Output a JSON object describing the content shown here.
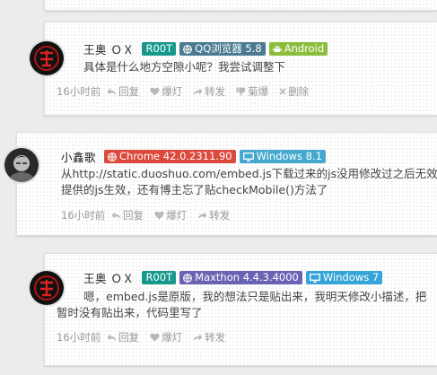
{
  "comments": [
    {
      "user": "王奥 ＯＸ",
      "badges": [
        {
          "label": "R00T",
          "icon": "",
          "color": "#17988c"
        },
        {
          "label": "QQ浏览器 5.8",
          "icon": "globe-icon",
          "color": "#4a7a92"
        },
        {
          "label": "Android",
          "icon": "android-icon",
          "color": "#8bbd3c"
        }
      ],
      "text": [
        "具体是什么地方空隙小呢？我尝试调整下"
      ],
      "time": "16小时前",
      "actions": {
        "reply": "回复",
        "like": "爆灯",
        "repost": "转发",
        "spam": "菊爆",
        "delete": "删除"
      }
    },
    {
      "user": "小鑫歌",
      "badges": [
        {
          "label": "Chrome 42.0.2311.90",
          "icon": "globe-icon",
          "color": "#db4a3c"
        },
        {
          "label": "Windows 8.1",
          "icon": "monitor-icon",
          "color": "#45a9cf"
        }
      ],
      "text": [
        "从http://static.duoshuo.com/embed.js下载过来的js没用修改过之后无效，",
        "提供的js生效，还有博主忘了贴checkMobile()方法了"
      ],
      "time": "16小时前",
      "actions": {
        "reply": "回复",
        "like": "爆灯",
        "repost": "转发"
      }
    },
    {
      "user": "王奥 ＯＸ",
      "badges": [
        {
          "label": "R00T",
          "icon": "",
          "color": "#17988c"
        },
        {
          "label": "Maxthon 4.4.3.4000",
          "icon": "globe-icon",
          "color": "#6a63b3"
        },
        {
          "label": "Windows 7",
          "icon": "monitor-icon",
          "color": "#35a4d6"
        }
      ],
      "text": [
        "嗯，embed.js是原版，我的想法只是贴出来，我明天修改小描述，把",
        "暂时没有贴出来，代码里写了"
      ],
      "time": "16小时前",
      "actions": {
        "reply": "回复",
        "like": "爆灯",
        "repost": "转发"
      }
    }
  ]
}
